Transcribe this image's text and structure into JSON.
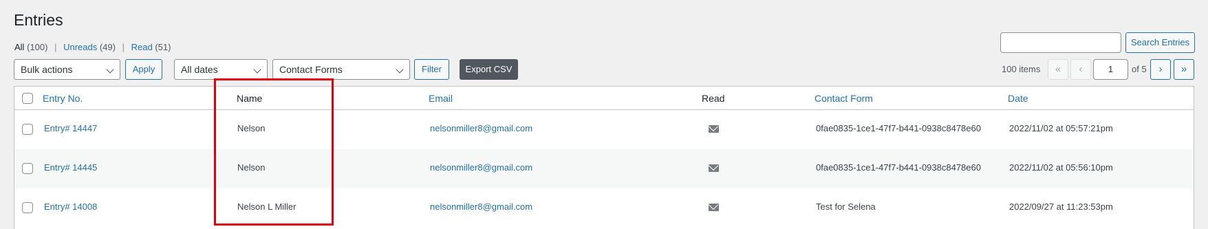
{
  "page": {
    "title": "Entries"
  },
  "filters": {
    "all_label": "All",
    "all_count": "(100)",
    "unreads_label": "Unreads",
    "unreads_count": "(49)",
    "read_label": "Read",
    "read_count": "(51)",
    "separator": "|"
  },
  "toolbar": {
    "bulk_actions": "Bulk actions",
    "apply": "Apply",
    "dates": "All dates",
    "forms": "Contact Forms",
    "filter": "Filter",
    "export": "Export CSV"
  },
  "search": {
    "button": "Search Entries",
    "value": ""
  },
  "pagination": {
    "items": "100 items",
    "first": "«",
    "prev": "‹",
    "current": "1",
    "of": "of 5",
    "next": "›",
    "last": "»"
  },
  "table": {
    "headers": {
      "entry_no": "Entry No.",
      "name": "Name",
      "email": "Email",
      "read": "Read",
      "contact_form": "Contact Form",
      "date": "Date"
    },
    "rows": [
      {
        "entry": "Entry# 14447",
        "name": "Nelson",
        "email": "nelsonmiller8@gmail.com",
        "read_icon": "envelope-icon",
        "form": "0fae0835-1ce1-47f7-b441-0938c8478e60",
        "date": "2022/11/02 at 05:57:21pm"
      },
      {
        "entry": "Entry# 14445",
        "name": "Nelson",
        "email": "nelsonmiller8@gmail.com",
        "read_icon": "envelope-icon",
        "form": "0fae0835-1ce1-47f7-b441-0938c8478e60",
        "date": "2022/11/02 at 05:56:10pm"
      },
      {
        "entry": "Entry# 14008",
        "name": "Nelson L Miller",
        "email": "nelsonmiller8@gmail.com",
        "read_icon": "envelope-icon",
        "form": "Test for Selena",
        "date": "2022/09/27 at 11:23:53pm"
      }
    ]
  },
  "colors": {
    "link": "#2271b1",
    "highlight": "#e2000e",
    "export_button": "#50575e"
  }
}
